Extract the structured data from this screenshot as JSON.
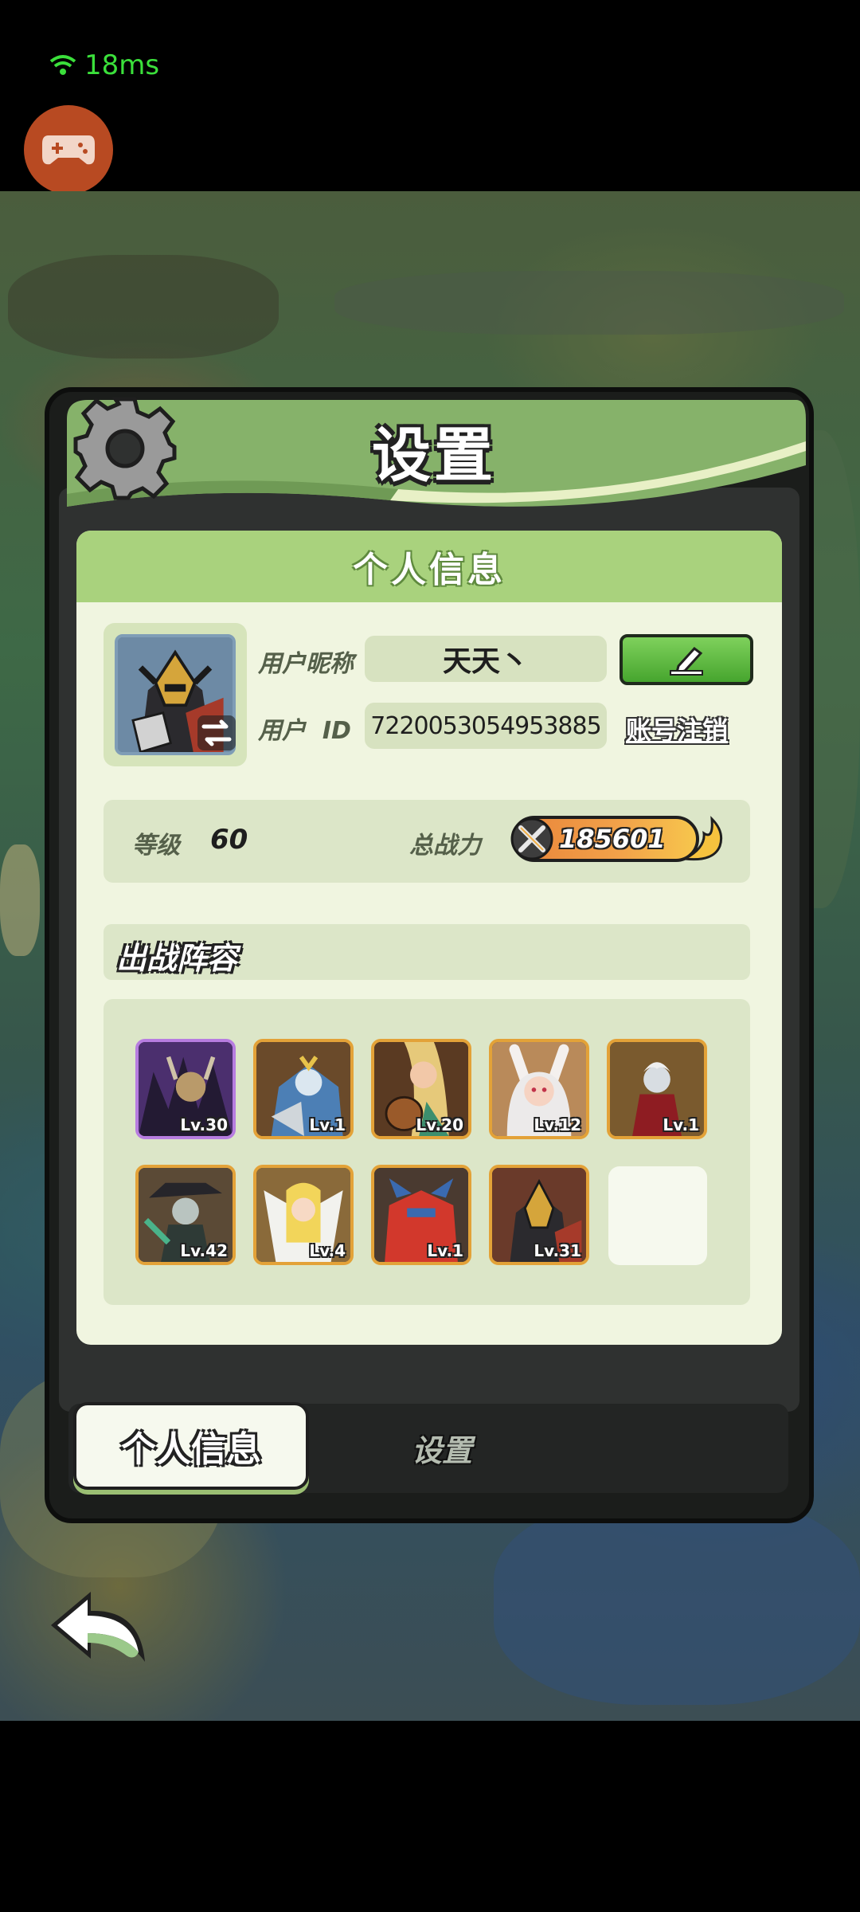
{
  "status": {
    "ping": "18ms"
  },
  "dialog": {
    "title": "设置",
    "card_title": "个人信息",
    "profile": {
      "nickname_label": "用户昵称",
      "nickname": "天天丶",
      "id_label": "用户  ID",
      "id": "7220053054953885",
      "cancel_account": "账号注销"
    },
    "stats": {
      "level_label": "等级",
      "level": "60",
      "power_label": "总战力",
      "power": "185601"
    },
    "lineup": {
      "title": "出战阵容",
      "heroes": [
        {
          "level": "Lv.30"
        },
        {
          "level": "Lv.1"
        },
        {
          "level": "Lv.20"
        },
        {
          "level": "Lv.12"
        },
        {
          "level": "Lv.1"
        },
        {
          "level": "Lv.42"
        },
        {
          "level": "Lv.4"
        },
        {
          "level": "Lv.1"
        },
        {
          "level": "Lv.31"
        }
      ]
    },
    "tabs": {
      "info": "个人信息",
      "settings": "设置"
    }
  }
}
